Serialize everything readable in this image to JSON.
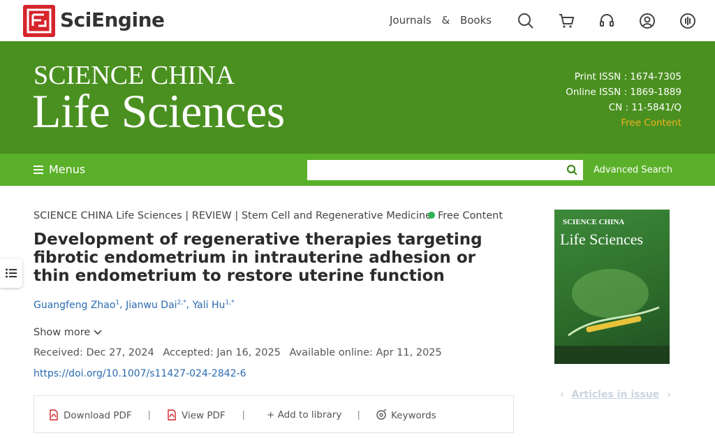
{
  "header": {
    "brand": "SciEngine",
    "nav": {
      "journals": "Journals",
      "amp": "&",
      "books": "Books"
    },
    "icons": [
      "search-icon",
      "cart-icon",
      "headset-icon",
      "user-icon",
      "podcast-icon"
    ]
  },
  "banner": {
    "journal_line1": "SCIENCE CHINA",
    "journal_line2": "Life Sciences",
    "print_issn": "Print ISSN : 1674-7305",
    "online_issn": "Online ISSN : 1869-1889",
    "cn": "CN : 11-5841/Q",
    "free_content": "Free Content"
  },
  "menubar": {
    "menus_label": "Menus",
    "search_placeholder": "",
    "advanced_search": "Advanced Search"
  },
  "article": {
    "meta": "SCIENCE CHINA Life Sciences | REVIEW | Stem Cell and Regenerative Medicine",
    "free_badge": "Free Content",
    "title": "Development of regenerative therapies targeting fibrotic endometrium in intrauterine adhesion or thin endometrium to restore uterine function",
    "authors": [
      {
        "name": "Guangfeng Zhao",
        "sup": "1"
      },
      {
        "name": "Jianwu Dai",
        "sup": "2,*"
      },
      {
        "name": "Yali Hu",
        "sup": "1,*"
      }
    ],
    "show_more": "Show more",
    "received": "Received: Dec 27, 2024",
    "accepted": "Accepted: Jan 16, 2025",
    "available": "Available online: Apr 11, 2025",
    "doi": "https://doi.org/10.1007/s11427-024-2842-6"
  },
  "actions": {
    "download_pdf": "Download PDF",
    "view_pdf": "View PDF",
    "add_library": "+ Add to library",
    "keywords": "Keywords",
    "separator": "|"
  },
  "cover": {
    "line1": "SCIENCE CHINA",
    "line2": "Life Sciences"
  },
  "issue_nav": {
    "label": "Articles in issue",
    "prev": "‹",
    "next": "›"
  },
  "colors": {
    "banner_green": "#4a9020",
    "menubar_green": "#5bb02a",
    "logo_red": "#d6242c",
    "link_blue": "#2a6bb0",
    "free_orange": "#f4b321",
    "free_dot": "#2fb155"
  }
}
